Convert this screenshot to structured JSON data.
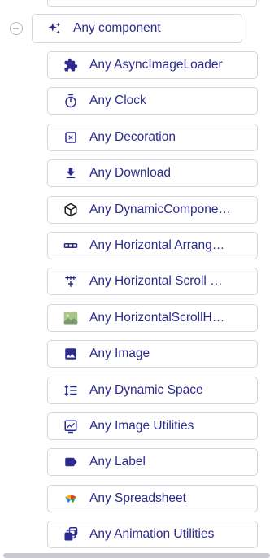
{
  "tree": {
    "parent": {
      "label": "Any component",
      "icon": "sparkle-icon"
    },
    "children": [
      {
        "label": "Any AsyncImageLoader",
        "icon": "puzzle-icon"
      },
      {
        "label": "Any Clock",
        "icon": "stopwatch-icon"
      },
      {
        "label": "Any Decoration",
        "icon": "decoration-icon"
      },
      {
        "label": "Any Download",
        "icon": "download-icon"
      },
      {
        "label": "Any DynamicCompone…",
        "icon": "cube-icon"
      },
      {
        "label": "Any Horizontal Arrang…",
        "icon": "horizontal-arrangement-icon"
      },
      {
        "label": "Any Horizontal Scroll …",
        "icon": "horizontal-scroll-icon"
      },
      {
        "label": "Any HorizontalScrollH…",
        "icon": "image-thumbnail-icon"
      },
      {
        "label": "Any Image",
        "icon": "image-icon"
      },
      {
        "label": "Any Dynamic Space",
        "icon": "line-spacing-icon"
      },
      {
        "label": "Any Image Utilities",
        "icon": "image-utilities-icon"
      },
      {
        "label": "Any Label",
        "icon": "label-tag-icon"
      },
      {
        "label": "Any Spreadsheet",
        "icon": "spreadsheet-icon"
      },
      {
        "label": "Any Animation Utilities",
        "icon": "animation-icon"
      }
    ]
  },
  "colors": {
    "text": "#2d2a8e",
    "icon": "#2d2a8e",
    "border": "#d6d6e0"
  }
}
